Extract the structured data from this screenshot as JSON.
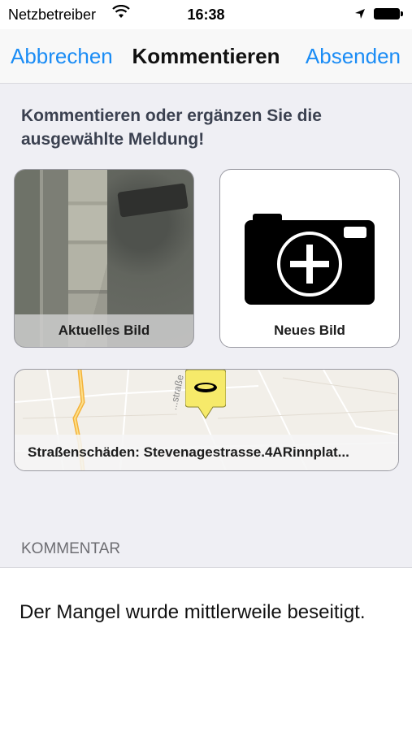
{
  "status_bar": {
    "carrier": "Netzbetreiber",
    "time": "16:38"
  },
  "nav": {
    "cancel_label": "Abbrechen",
    "title": "Kommentieren",
    "send_label": "Absenden"
  },
  "instruction": "Kommentieren oder ergänzen Sie die ausgewählte Meldung!",
  "cards": {
    "current_photo_label": "Aktuelles Bild",
    "new_photo_label": "Neues Bild"
  },
  "map": {
    "street_name": "...straße",
    "report_label": "Straßenschäden: Stevenagestrasse.4ARinnplat..."
  },
  "comment": {
    "section_header": "KOMMENTAR",
    "text": "Der Mangel wurde mittlerweile beseitigt."
  },
  "colors": {
    "accent": "#1a8cf5",
    "background": "#efeff4",
    "pin": "#f6ea6a"
  },
  "icons": [
    "wifi-icon",
    "location-arrow-icon",
    "battery-icon",
    "camera-add-icon",
    "map-pin-icon"
  ]
}
